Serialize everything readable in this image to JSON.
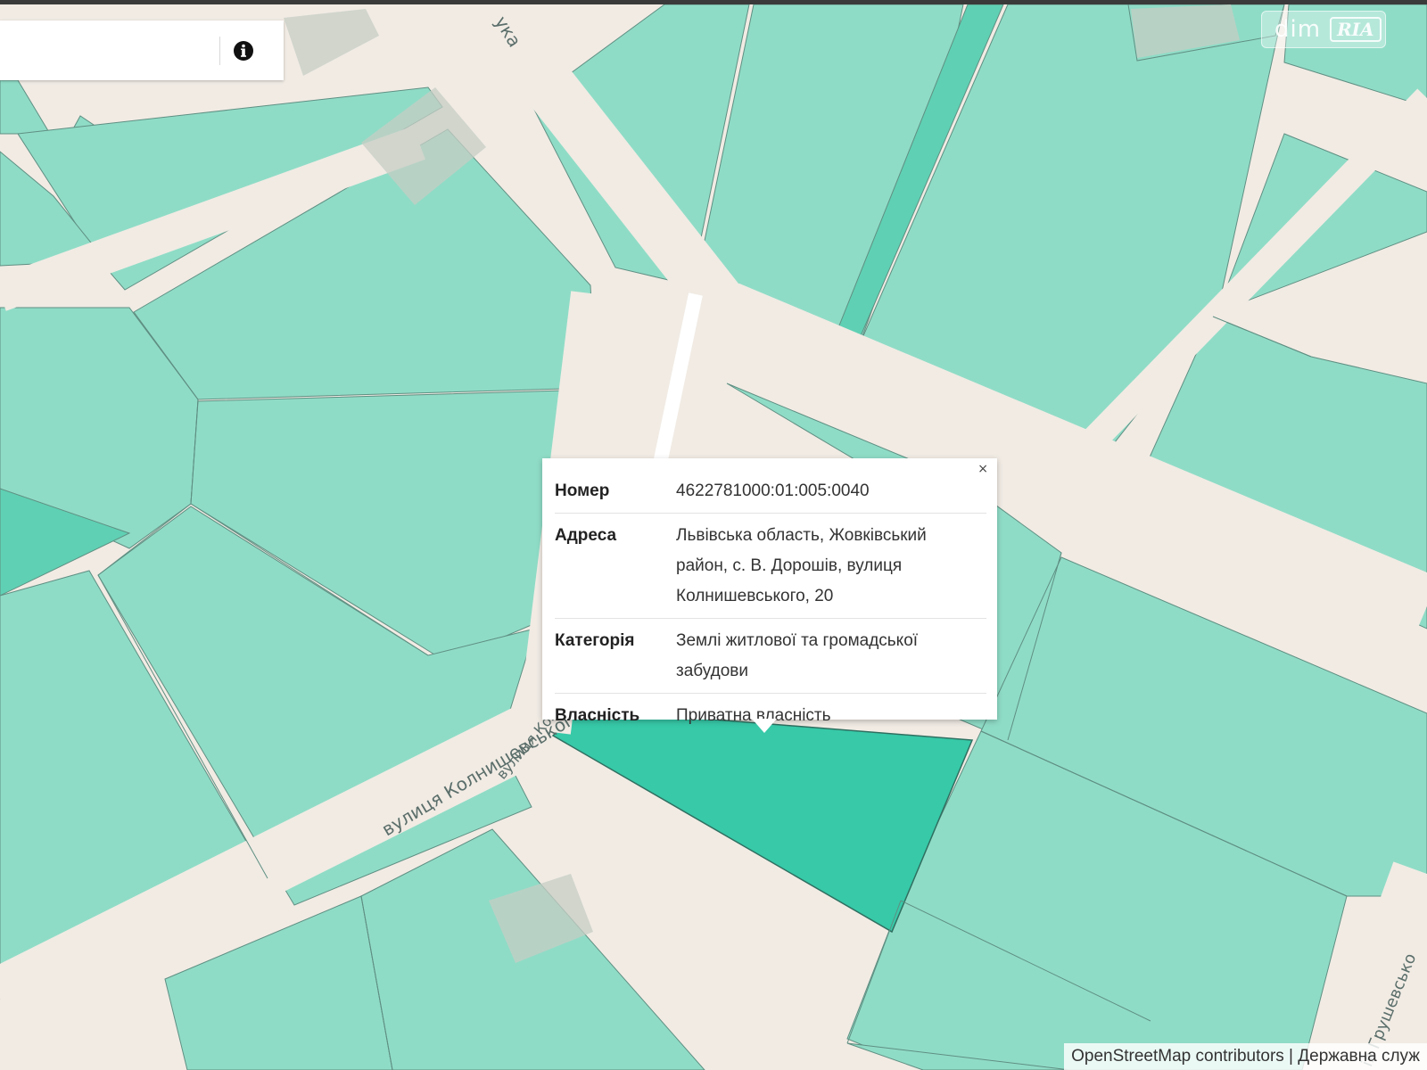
{
  "search": {
    "placeholder": ""
  },
  "info_button": {
    "icon": "info-icon"
  },
  "watermark": {
    "part1": "dim",
    "part2": "RIA"
  },
  "streets": {
    "top": "ука",
    "kolnyshevskoho": "вулиця Колнишевськог",
    "kolnyshevskoho_short": "вулиця Колнишевськог",
    "hrushevskoho": "ія Грушевсько"
  },
  "popup": {
    "close_label": "×",
    "rows": [
      {
        "key": "Номер",
        "value": "4622781000:01:005:0040"
      },
      {
        "key": "Адреса",
        "value": "Львівська область, Жовківський район, с. В. Дорошів, вулиця Колнишевського, 20"
      },
      {
        "key": "Категорія",
        "value": "Землі житлової та громадської забудови"
      },
      {
        "key": "Власність",
        "value": "Приватна власність"
      }
    ]
  },
  "attribution": {
    "text": "OpenStreetMap contributors | Державна служ"
  },
  "colors": {
    "parcel": "#8fdcc6",
    "parcel_selected": "#37c9a8",
    "road": "#f1ebe4",
    "building": "#c5cdc4"
  }
}
